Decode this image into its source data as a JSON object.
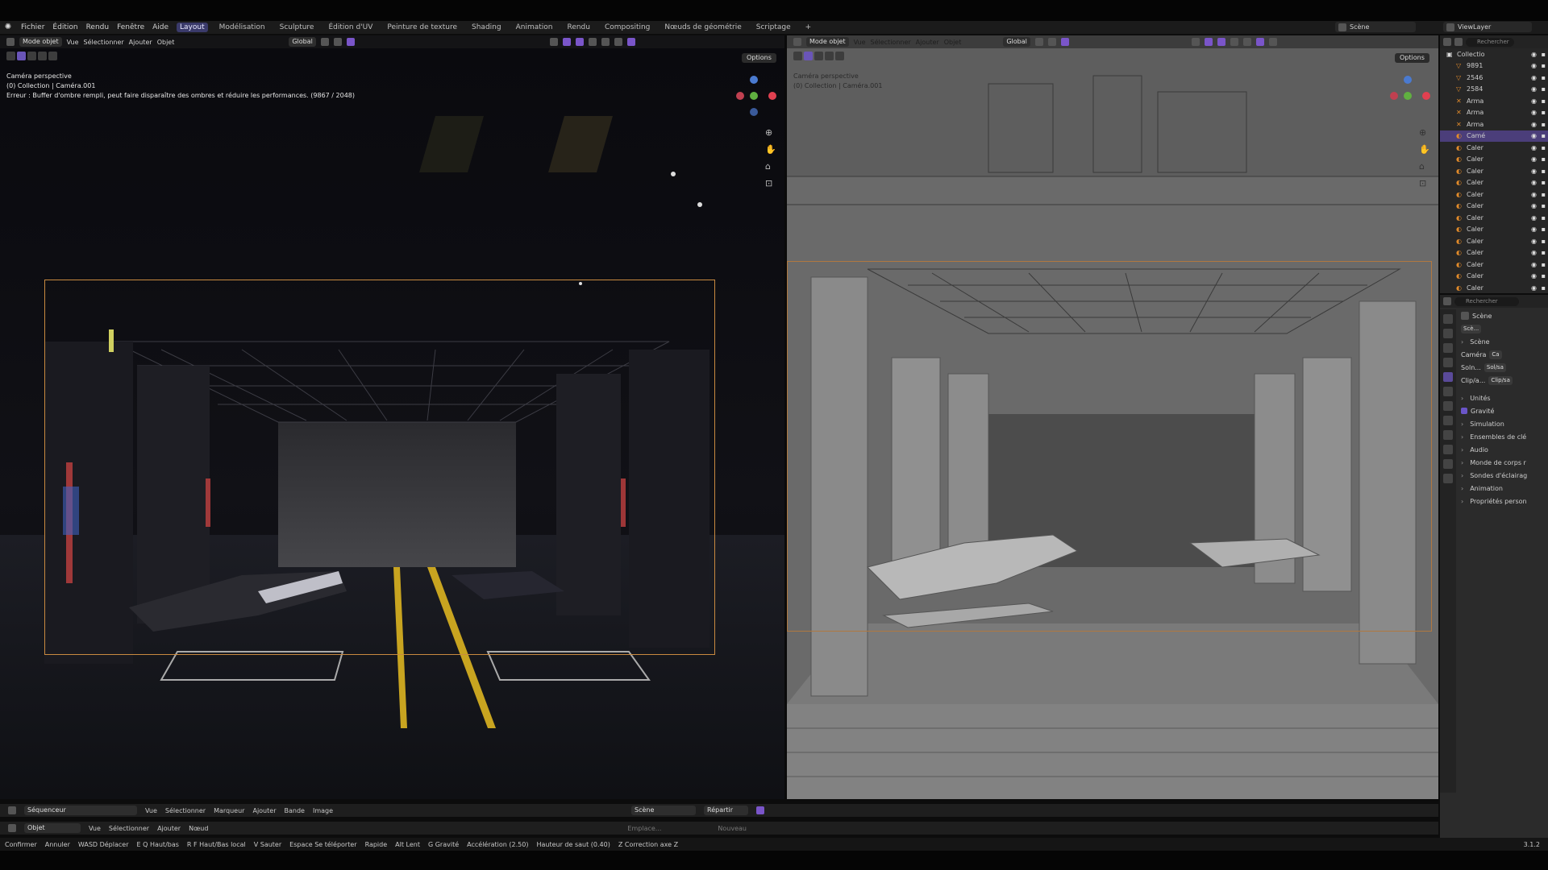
{
  "menu": {
    "items": [
      "Fichier",
      "Édition",
      "Rendu",
      "Fenêtre",
      "Aide"
    ],
    "workspaces": [
      "Layout",
      "Modélisation",
      "Sculpture",
      "Édition d'UV",
      "Peinture de texture",
      "Shading",
      "Animation",
      "Rendu",
      "Compositing",
      "Nœuds de géométrie",
      "Scriptage"
    ],
    "active_workspace": "Layout",
    "add_tab": "+",
    "scene_label": "Scène",
    "view_layer_label": "ViewLayer"
  },
  "left_viewport": {
    "mode": "Mode objet",
    "menus": [
      "Vue",
      "Sélectionner",
      "Ajouter",
      "Objet"
    ],
    "orientation": "Global",
    "options": "Options",
    "camera_label": "Caméra perspective",
    "collection_label": "(0) Collection | Caméra.001",
    "error_text": "Erreur : Buffer d'ombre rempli, peut faire disparaître des ombres et réduire les performances. (9867 / 2048)"
  },
  "right_viewport": {
    "mode": "Mode objet",
    "menus": [
      "Vue",
      "Sélectionner",
      "Ajouter",
      "Objet"
    ],
    "orientation": "Global",
    "options": "Options",
    "camera_label": "Caméra perspective",
    "collection_label": "(0) Collection | Caméra.001"
  },
  "sequencer": {
    "editor": "Séquenceur",
    "menus": [
      "Vue",
      "Sélectionner",
      "Marqueur",
      "Ajouter",
      "Bande",
      "Image"
    ],
    "scene": "Scène",
    "mode": "Répartir"
  },
  "node_header": {
    "type": "Objet",
    "menus": [
      "Vue",
      "Sélectionner",
      "Ajouter",
      "Nœud"
    ],
    "slot": "Emplace...",
    "new": "Nouveau"
  },
  "status": {
    "items": [
      "Confirmer",
      "Annuler",
      "WASD Déplacer",
      "E Q Haut/bas",
      "R F Haut/Bas local",
      "V Sauter",
      "Espace Se téléporter",
      "Rapide",
      "Alt Lent",
      "G Gravité",
      "Accélération (2.50)",
      "Hauteur de saut (0.40)",
      "Z Correction axe Z"
    ],
    "version": "3.1.2"
  },
  "outliner": {
    "search_placeholder": "Rechercher",
    "collection": "Collectio",
    "rows": [
      "9891",
      "2546",
      "2584",
      "Arma",
      "Arma",
      "Arma",
      "Camé",
      "Caler",
      "Caler",
      "Caler",
      "Caler",
      "Caler",
      "Caler",
      "Caler",
      "Caler",
      "Caler",
      "Caler",
      "Caler",
      "Caler",
      "Caler"
    ],
    "active_row": 6
  },
  "properties": {
    "search_placeholder": "Rechercher",
    "context": "Scène",
    "scene_name": "Scè...",
    "section_scene": "Scène",
    "camera_label": "Caméra",
    "camera_value": "Ca",
    "background_label": "Soln...",
    "background_value": "Sol/sa",
    "clip_label": "Clip/a...",
    "clip_value": "Clip/sa",
    "sections": [
      "Unités",
      "Gravité",
      "Simulation",
      "Ensembles de clé",
      "Audio",
      "Monde de corps r",
      "Sondes d'éclairag",
      "Animation",
      "Propriétés person"
    ]
  }
}
